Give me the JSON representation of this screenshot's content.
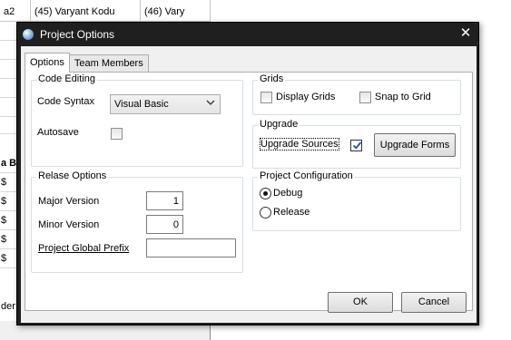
{
  "background": {
    "columns": [
      "a2",
      "(45) Varyant Kodu",
      "(46) Vary"
    ],
    "rows": [
      "",
      "",
      "",
      "",
      "",
      "",
      "",
      "",
      "",
      "",
      "a B",
      "$",
      "$",
      "$",
      "$",
      "$",
      "$"
    ],
    "bottom_text": "der"
  },
  "dialog": {
    "title": "Project Options",
    "close_glyph": "✕",
    "tabs": [
      {
        "label": "Options",
        "active": true
      },
      {
        "label": "Team Members",
        "active": false
      }
    ],
    "code_editing": {
      "title": "Code Editing",
      "syntax_label": "Code Syntax",
      "syntax_value": "Visual Basic",
      "autosave_label": "Autosave",
      "autosave_checked": false
    },
    "release_options": {
      "title": "Relase Options",
      "major_label": "Major Version",
      "major_value": "1",
      "minor_label": "Minor Version",
      "minor_value": "0",
      "prefix_label": "Project Global Prefix",
      "prefix_value": ""
    },
    "grids": {
      "title": "Grids",
      "display_label": "Display Grids",
      "display_checked": false,
      "snap_label": "Snap to Grid",
      "snap_checked": false
    },
    "upgrade": {
      "title": "Upgrade",
      "sources_label": "Upgrade Sources",
      "sources_checked": true,
      "forms_button": "Upgrade Forms"
    },
    "project_configuration": {
      "title": "Project Configuration",
      "options": [
        "Debug",
        "Release"
      ],
      "selected": "Debug"
    },
    "buttons": {
      "ok": "OK",
      "cancel": "Cancel"
    }
  },
  "icons": {
    "title_icon": "app-globe-icon",
    "close": "close-icon",
    "chevron": "chevron-down-icon",
    "check": "check-icon"
  },
  "colors": {
    "titlebar": "#1f1f1f",
    "dialog_face": "#f0f0f0",
    "panel": "#ffffff",
    "check_mark": "#1e4fa0"
  }
}
